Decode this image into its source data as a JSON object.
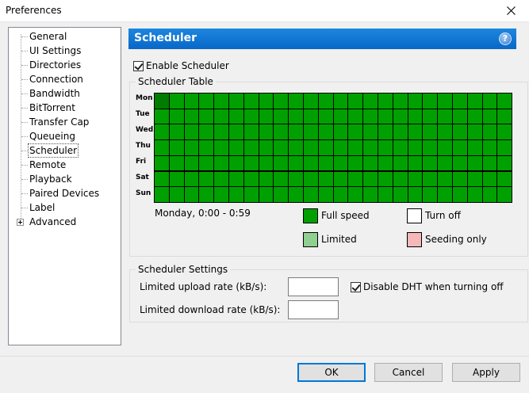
{
  "window": {
    "title": "Preferences"
  },
  "sidebar": {
    "items": [
      {
        "label": "General"
      },
      {
        "label": "UI Settings"
      },
      {
        "label": "Directories"
      },
      {
        "label": "Connection"
      },
      {
        "label": "Bandwidth"
      },
      {
        "label": "BitTorrent"
      },
      {
        "label": "Transfer Cap"
      },
      {
        "label": "Queueing"
      },
      {
        "label": "Scheduler",
        "selected": true
      },
      {
        "label": "Remote"
      },
      {
        "label": "Playback"
      },
      {
        "label": "Paired Devices"
      },
      {
        "label": "Label"
      },
      {
        "label": "Advanced",
        "expandable": true
      }
    ]
  },
  "header": {
    "title": "Scheduler",
    "help": "?"
  },
  "enable_scheduler": {
    "label": "Enable Scheduler",
    "checked": true
  },
  "scheduler_table": {
    "title": "Scheduler Table",
    "days": [
      "Mon",
      "Tue",
      "Wed",
      "Thu",
      "Fri",
      "Sat",
      "Sun"
    ],
    "hours": 24,
    "status": "Monday, 0:00 - 0:59",
    "legend": [
      {
        "label": "Full speed",
        "color": "#00a000"
      },
      {
        "label": "Turn off",
        "color": "#ffffff"
      },
      {
        "label": "Limited",
        "color": "#8fcf8f"
      },
      {
        "label": "Seeding only",
        "color": "#f4b8b8"
      }
    ]
  },
  "scheduler_settings": {
    "title": "Scheduler Settings",
    "upload_label": "Limited upload rate (kB/s):",
    "upload_value": "",
    "download_label": "Limited download rate (kB/s):",
    "download_value": "",
    "dht": {
      "label": "Disable DHT when turning off",
      "checked": true
    }
  },
  "buttons": {
    "ok": "OK",
    "cancel": "Cancel",
    "apply": "Apply"
  },
  "colors": {
    "accent": "#0867c7",
    "full_speed": "#00a000"
  }
}
